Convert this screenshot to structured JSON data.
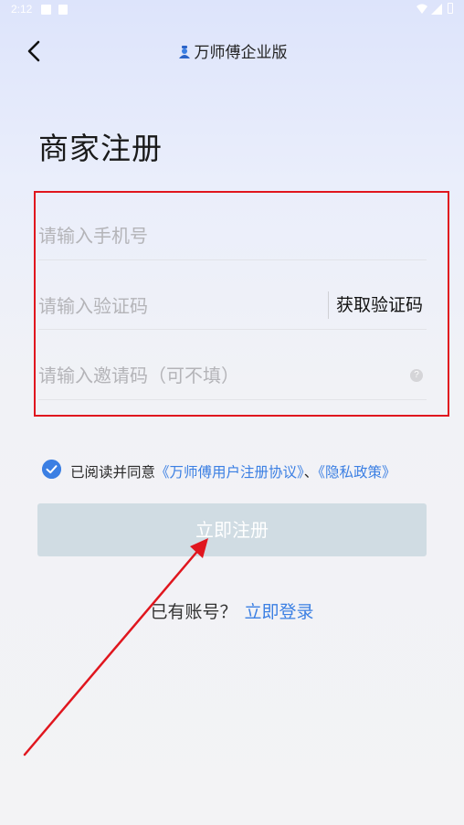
{
  "status_bar": {
    "time": "2:12"
  },
  "header": {
    "title": "万师傅企业版"
  },
  "page_title": "商家注册",
  "form": {
    "phone_placeholder": "请输入手机号",
    "code_placeholder": "请输入验证码",
    "get_code_label": "获取验证码",
    "invite_placeholder": "请输入邀请码（可不填）",
    "help_symbol": "?"
  },
  "agreement": {
    "prefix": "已阅读并同意",
    "user_agreement": "《万师傅用户注册协议》",
    "separator": "、",
    "privacy_policy": "《隐私政策》",
    "checked": true
  },
  "register_button": "立即注册",
  "login": {
    "prompt": "已有账号？",
    "link": "立即登录"
  },
  "colors": {
    "accent": "#3b7fe3",
    "register_button_bg": "#d0dce3",
    "annotation_red": "#e0161e"
  }
}
